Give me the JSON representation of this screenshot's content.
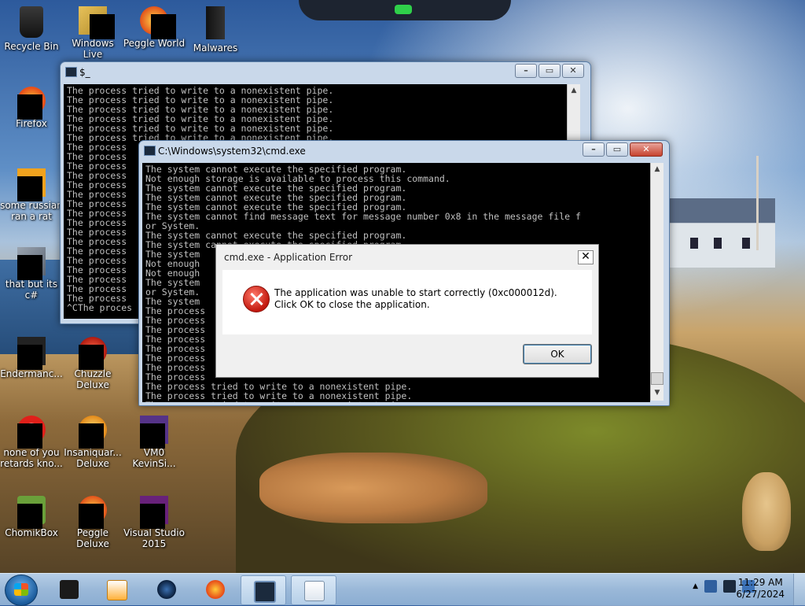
{
  "desktop": {
    "icons": [
      {
        "label": "Recycle Bin"
      },
      {
        "label": "Windows Live"
      },
      {
        "label": "Peggle World"
      },
      {
        "label": "Malwares"
      },
      {
        "label": "Firefox"
      },
      {
        "label": "some russian ran a rat"
      },
      {
        "label": "that but its c#"
      },
      {
        "label": "Endermanc..."
      },
      {
        "label": "Chuzzle Deluxe"
      },
      {
        "label": "none of you retards kno..."
      },
      {
        "label": "Insaniquar... Deluxe"
      },
      {
        "label": "VM0 KevinSi..."
      },
      {
        "label": "ChomikBox"
      },
      {
        "label": "Peggle Deluxe"
      },
      {
        "label": "Visual Studio 2015"
      }
    ]
  },
  "window_back": {
    "title": "$_",
    "lines": [
      "The process tried to write to a nonexistent pipe.",
      "The process tried to write to a nonexistent pipe.",
      "The process tried to write to a nonexistent pipe.",
      "The process tried to write to a nonexistent pipe.",
      "The process tried to write to a nonexistent pipe.",
      "The process tried to write to a nonexistent pipe.",
      "The process",
      "The process",
      "The process",
      "The process",
      "The process",
      "The process",
      "The process",
      "The process",
      "The process",
      "The process",
      "The process",
      "The process",
      "The process",
      "The process",
      "The process",
      "The process",
      "The process",
      "^CThe proces"
    ]
  },
  "window_cmd": {
    "title": "C:\\Windows\\system32\\cmd.exe",
    "lines": [
      "The system cannot execute the specified program.",
      "Not enough storage is available to process this command.",
      "The system cannot execute the specified program.",
      "The system cannot execute the specified program.",
      "The system cannot execute the specified program.",
      "The system cannot find message text for message number 0x8 in the message file f",
      "or System.",
      "The system cannot execute the specified program.",
      "The system cannot execute the specified program.",
      "The system",
      "Not enough",
      "Not enough",
      "The system                                                                  file f",
      "or System.",
      "The system",
      "The process",
      "The process",
      "The process",
      "The process",
      "The process",
      "The process",
      "The process",
      "The process",
      "The process tried to write to a nonexistent pipe.",
      "The process tried to write to a nonexistent pipe.",
      "The process tried to write to a nonexistent pipe."
    ]
  },
  "dialog": {
    "title": "cmd.exe - Application Error",
    "message": "The application was unable to start correctly (0xc000012d). Click OK to close the application.",
    "ok_label": "OK",
    "close_symbol": "✕"
  },
  "controls": {
    "min_symbol": "–",
    "max_symbol": "▭",
    "close_symbol": "✕"
  },
  "taskbar": {
    "time": "11:29 AM",
    "date": "6/27/2024",
    "tray_expand": "▲"
  }
}
